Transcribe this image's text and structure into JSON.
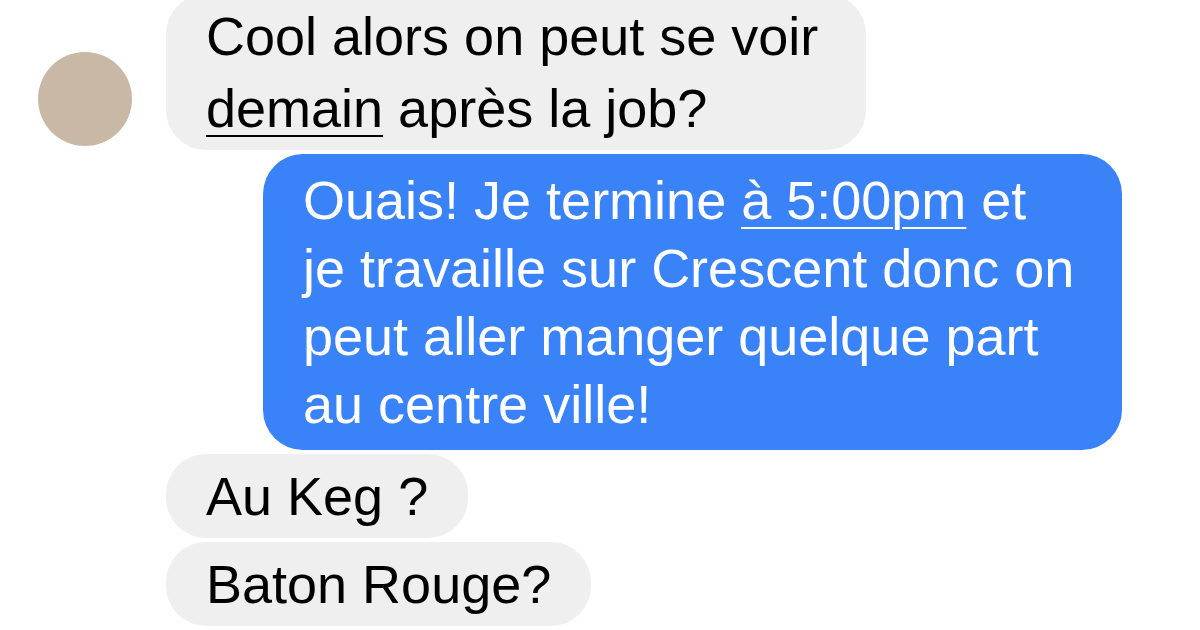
{
  "messages": [
    {
      "kind": "received",
      "show_avatar": true,
      "segments": [
        {
          "text": "Cool alors on peut se voir ",
          "link": false
        },
        {
          "text": "demain",
          "link": true
        },
        {
          "text": " après la job?",
          "link": false
        }
      ]
    },
    {
      "kind": "sent",
      "show_avatar": false,
      "segments": [
        {
          "text": "Ouais! Je termine ",
          "link": false
        },
        {
          "text": "à 5:00pm",
          "link": true
        },
        {
          "text": " et je travaille sur Crescent donc on peut aller manger quelque part au centre ville!",
          "link": false
        }
      ]
    },
    {
      "kind": "received",
      "show_avatar": false,
      "segments": [
        {
          "text": "Au Keg ?",
          "link": false
        }
      ]
    },
    {
      "kind": "received",
      "show_avatar": false,
      "segments": [
        {
          "text": "Baton Rouge?",
          "link": false
        }
      ]
    }
  ]
}
